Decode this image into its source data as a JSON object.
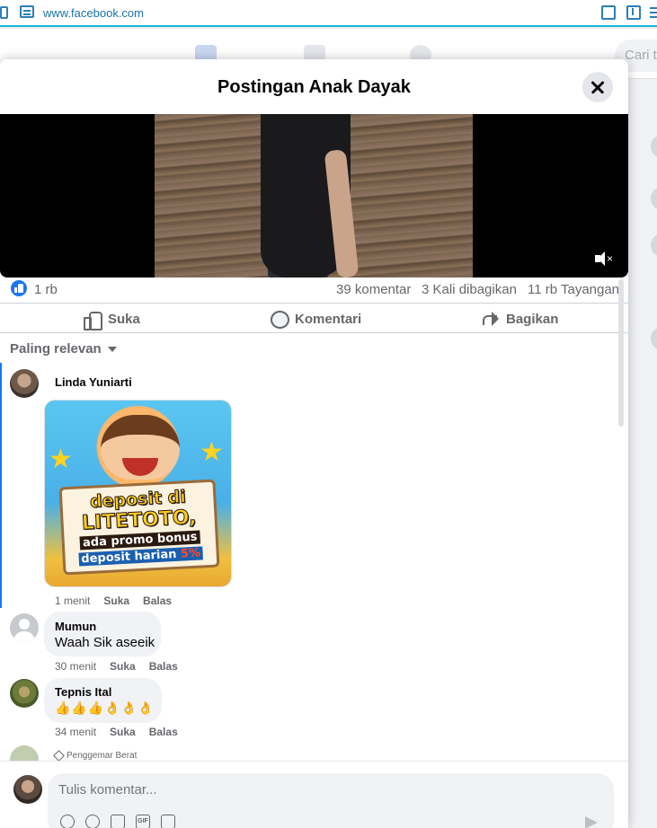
{
  "browser": {
    "url": "www.facebook.com"
  },
  "background": {
    "search_placeholder": "Cari t"
  },
  "modal": {
    "title": "Postingan Anak Dayak"
  },
  "stats": {
    "reactions": "1 rb",
    "comments": "39 komentar",
    "shares": "3 Kali dibagikan",
    "views": "11 rb Tayangan"
  },
  "actions": {
    "like": "Suka",
    "comment": "Komentari",
    "share": "Bagikan"
  },
  "sort": {
    "label": "Paling relevan"
  },
  "comments": [
    {
      "name": "Linda Yuniarti",
      "text": "",
      "image_text": {
        "line1": "deposit di",
        "line2": "LITETOTO,",
        "line3": "ada promo bonus",
        "line4": "deposit harian",
        "percent": "5%"
      },
      "time": "1 menit",
      "like": "Suka",
      "reply": "Balas"
    },
    {
      "name": "Mumun",
      "text": "Waah Sik aseeik",
      "time": "30 menit",
      "like": "Suka",
      "reply": "Balas"
    },
    {
      "name": "Tepnis Ital",
      "text": "👍👍👍👌👌👌",
      "time": "34 menit",
      "like": "Suka",
      "reply": "Balas"
    }
  ],
  "next_comment": {
    "badge": "Penggemar Berat"
  },
  "composer": {
    "placeholder": "Tulis komentar..."
  }
}
